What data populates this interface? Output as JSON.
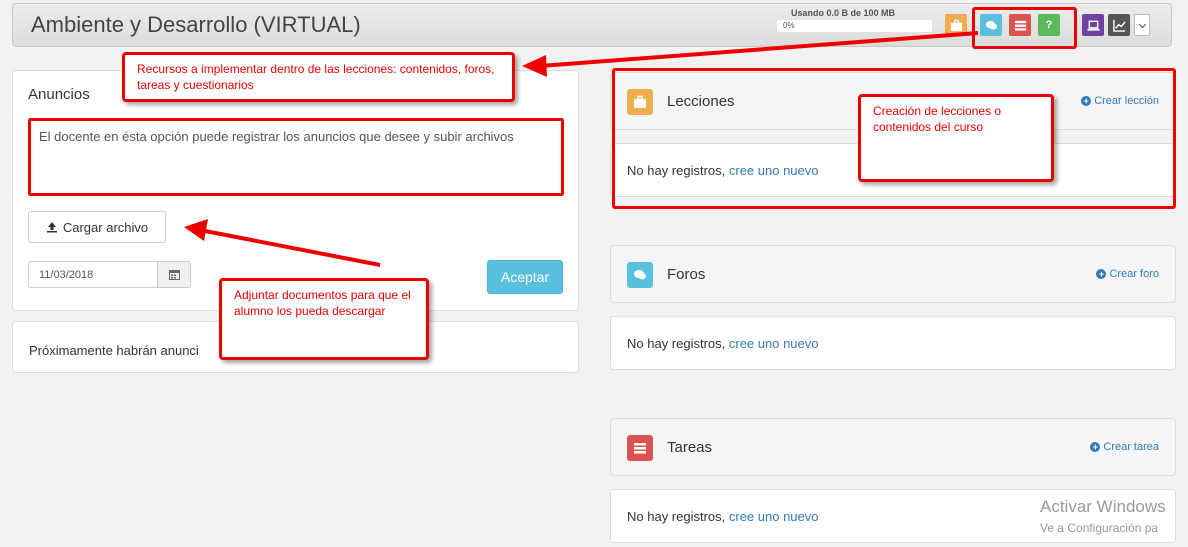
{
  "header": {
    "title": "Ambiente y Desarrollo (VIRTUAL)",
    "usage_text": "Usando 0.0 B de 100 MB",
    "usage_percent": "0%",
    "help_glyph": "?"
  },
  "toolbar": {
    "icons": [
      "briefcase-icon",
      "comments-icon",
      "tasks-icon",
      "question-icon",
      "laptop-icon",
      "chart-icon",
      "chevron-down-icon"
    ],
    "colors": {
      "lecciones": "#f0ad4e",
      "foros": "#5bc0de",
      "tareas": "#d9534f",
      "cuestionarios": "#5cb85c",
      "laptop": "#6f42a0",
      "chart": "#555555"
    }
  },
  "announcements": {
    "label": "Anuncios",
    "textarea_value": "El docente en ésta opción puede registrar los anuncios que desee y subir archivos",
    "upload_button": "Cargar archivo",
    "date_value": "11/03/2018",
    "accept_button": "Aceptar",
    "upcoming_text": "Próximamente habrán anunci"
  },
  "sections": [
    {
      "title": "Lecciones",
      "link": "Crear lección",
      "empty_text": "No hay registros, ",
      "empty_link": "cree uno nuevo"
    },
    {
      "title": "Foros",
      "link": "Crear foro",
      "empty_text": "No hay registros, ",
      "empty_link": "cree uno nuevo"
    },
    {
      "title": "Tareas",
      "link": "Crear tarea",
      "empty_text": "No hay registros, ",
      "empty_link": "cree uno nuevo"
    }
  ],
  "annotations": {
    "resources": "Recursos a implementar dentro de las lecciones: contenidos, foros, tareas y cuestionarios",
    "lessons": "Creación de lecciones o contenidos del curso",
    "attach": "Adjuntar documentos para que el alumno los pueda descargar"
  },
  "watermark": {
    "line1": "Activar Windows",
    "line2": "Ve a Configuración pa"
  }
}
